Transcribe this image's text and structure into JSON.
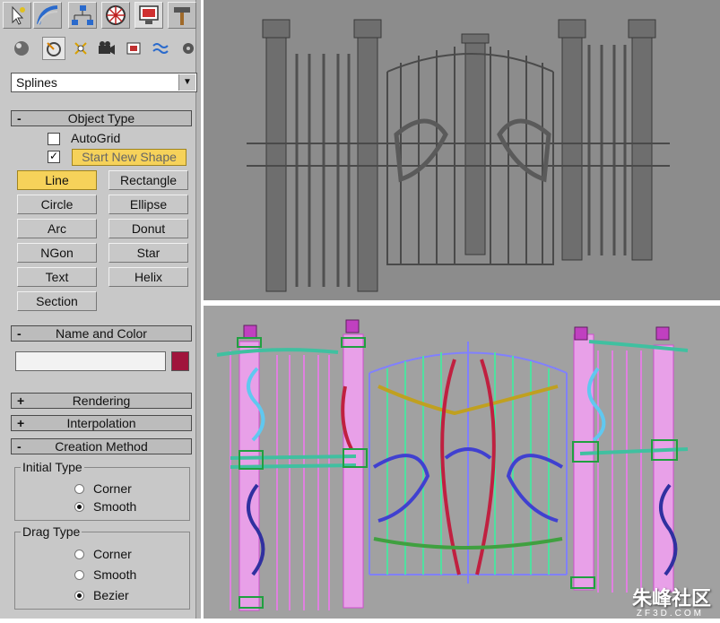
{
  "panel": {
    "dropdown": {
      "selected": "Splines"
    },
    "object_type": {
      "title": "Object Type",
      "autogrid_label": "AutoGrid",
      "start_new_shape_label": "Start New Shape",
      "buttons": [
        "Line",
        "Rectangle",
        "Circle",
        "Ellipse",
        "Arc",
        "Donut",
        "NGon",
        "Star",
        "Text",
        "Helix",
        "Section"
      ],
      "active_button": "Line"
    },
    "name_and_color": {
      "title": "Name and Color",
      "name_value": "",
      "color": "#a0143c"
    },
    "rollouts": {
      "rendering": "Rendering",
      "interpolation": "Interpolation",
      "creation_method": "Creation Method"
    },
    "initial_type": {
      "title": "Initial Type",
      "options": [
        "Corner",
        "Smooth"
      ],
      "selected": "Smooth"
    },
    "drag_type": {
      "title": "Drag Type",
      "options": [
        "Corner",
        "Smooth",
        "Bezier"
      ],
      "selected": "Bezier"
    }
  },
  "tabs": [
    "create-tab",
    "modify-tab",
    "hierarchy-tab",
    "motion-tab",
    "display-tab",
    "utilities-tab"
  ],
  "subicons": [
    "geometry-icon",
    "shapes-icon",
    "lights-icon",
    "cameras-icon",
    "helpers-icon",
    "spacewarps-icon",
    "systems-icon"
  ],
  "watermark": {
    "brand": "朱峰社区",
    "site": "ZF3D.COM"
  }
}
